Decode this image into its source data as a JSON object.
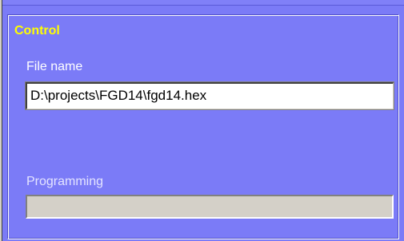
{
  "group": {
    "title": "Control"
  },
  "file_name": {
    "label": "File name",
    "value": "D:\\projects\\FGD14\\fgd14.hex"
  },
  "programming": {
    "label": "Programming",
    "progress": 0
  },
  "colors": {
    "background": "#7b7bf7",
    "title": "#ffff00",
    "label": "#ffffff",
    "progress_track": "#d4d0c8"
  }
}
